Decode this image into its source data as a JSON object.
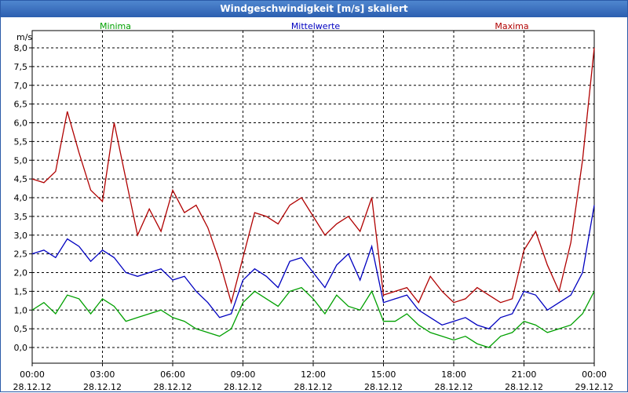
{
  "window": {
    "title": "Windgeschwindigkeit [m/s] skaliert"
  },
  "colors": {
    "minima": "#00a000",
    "mittelwerte": "#0000c0",
    "maxima": "#b00000",
    "grid": "#000000"
  },
  "chart_data": {
    "type": "line",
    "title": "Windgeschwindigkeit [m/s] skaliert",
    "ylabel": "m/s",
    "ylim": [
      0,
      8
    ],
    "yticks": [
      "0,0",
      "0,5",
      "1,0",
      "1,5",
      "2,0",
      "2,5",
      "3,0",
      "3,5",
      "4,0",
      "4,5",
      "5,0",
      "5,5",
      "6,0",
      "6,5",
      "7,0",
      "7,5",
      "8,0"
    ],
    "xlim": [
      "28.12.12 00:00",
      "29.12.12 00:00"
    ],
    "xticks": [
      {
        "time": "00:00",
        "date": "28.12.12"
      },
      {
        "time": "03:00",
        "date": "28.12.12"
      },
      {
        "time": "06:00",
        "date": "28.12.12"
      },
      {
        "time": "09:00",
        "date": "28.12.12"
      },
      {
        "time": "12:00",
        "date": "28.12.12"
      },
      {
        "time": "15:00",
        "date": "28.12.12"
      },
      {
        "time": "18:00",
        "date": "28.12.12"
      },
      {
        "time": "21:00",
        "date": "28.12.12"
      },
      {
        "time": "00:00",
        "date": "29.12.12"
      }
    ],
    "grid": true,
    "legend": "top",
    "series": [
      {
        "name": "Minima",
        "color": "#00a000",
        "x_hours": [
          0,
          0.5,
          1,
          1.5,
          2,
          2.5,
          3,
          3.5,
          4,
          4.5,
          5,
          5.5,
          6,
          6.5,
          7,
          7.5,
          8,
          8.5,
          9,
          9.5,
          10,
          10.5,
          11,
          11.5,
          12,
          12.5,
          13,
          13.5,
          14,
          14.5,
          15,
          15.5,
          16,
          16.5,
          17,
          17.5,
          18,
          18.5,
          19,
          19.5,
          20,
          20.5,
          21,
          21.5,
          22,
          22.5,
          23,
          23.5,
          24
        ],
        "values": [
          1.0,
          1.2,
          0.9,
          1.4,
          1.3,
          0.9,
          1.3,
          1.1,
          0.7,
          0.8,
          0.9,
          1.0,
          0.8,
          0.7,
          0.5,
          0.4,
          0.3,
          0.5,
          1.2,
          1.5,
          1.3,
          1.1,
          1.5,
          1.6,
          1.3,
          0.9,
          1.4,
          1.1,
          1.0,
          1.5,
          0.7,
          0.7,
          0.9,
          0.6,
          0.4,
          0.3,
          0.2,
          0.3,
          0.1,
          0.0,
          0.3,
          0.4,
          0.7,
          0.6,
          0.4,
          0.5,
          0.6,
          0.9,
          1.5
        ]
      },
      {
        "name": "Mittelwerte",
        "color": "#0000c0",
        "x_hours": [
          0,
          0.5,
          1,
          1.5,
          2,
          2.5,
          3,
          3.5,
          4,
          4.5,
          5,
          5.5,
          6,
          6.5,
          7,
          7.5,
          8,
          8.5,
          9,
          9.5,
          10,
          10.5,
          11,
          11.5,
          12,
          12.5,
          13,
          13.5,
          14,
          14.5,
          15,
          15.5,
          16,
          16.5,
          17,
          17.5,
          18,
          18.5,
          19,
          19.5,
          20,
          20.5,
          21,
          21.5,
          22,
          22.5,
          23,
          23.5,
          24
        ],
        "values": [
          2.5,
          2.6,
          2.4,
          2.9,
          2.7,
          2.3,
          2.6,
          2.4,
          2.0,
          1.9,
          2.0,
          2.1,
          1.8,
          1.9,
          1.5,
          1.2,
          0.8,
          0.9,
          1.8,
          2.1,
          1.9,
          1.6,
          2.3,
          2.4,
          2.0,
          1.6,
          2.2,
          2.5,
          1.8,
          2.7,
          1.2,
          1.3,
          1.4,
          1.0,
          0.8,
          0.6,
          0.7,
          0.8,
          0.6,
          0.5,
          0.8,
          0.9,
          1.5,
          1.4,
          1.0,
          1.2,
          1.4,
          2.0,
          3.8
        ]
      },
      {
        "name": "Maxima",
        "color": "#b00000",
        "x_hours": [
          0,
          0.5,
          1,
          1.5,
          2,
          2.5,
          3,
          3.5,
          4,
          4.5,
          5,
          5.5,
          6,
          6.5,
          7,
          7.5,
          8,
          8.5,
          9,
          9.5,
          10,
          10.5,
          11,
          11.5,
          12,
          12.5,
          13,
          13.5,
          14,
          14.5,
          15,
          15.5,
          16,
          16.5,
          17,
          17.5,
          18,
          18.5,
          19,
          19.5,
          20,
          20.5,
          21,
          21.5,
          22,
          22.5,
          23,
          23.5,
          24
        ],
        "values": [
          4.5,
          4.4,
          4.7,
          6.3,
          5.2,
          4.2,
          3.9,
          6.0,
          4.5,
          3.0,
          3.7,
          3.1,
          4.2,
          3.6,
          3.8,
          3.2,
          2.3,
          1.2,
          2.4,
          3.6,
          3.5,
          3.3,
          3.8,
          4.0,
          3.5,
          3.0,
          3.3,
          3.5,
          3.1,
          4.0,
          1.4,
          1.5,
          1.6,
          1.2,
          1.9,
          1.5,
          1.2,
          1.3,
          1.6,
          1.4,
          1.2,
          1.3,
          2.6,
          3.1,
          2.2,
          1.5,
          2.8,
          5.0,
          8.0
        ]
      }
    ]
  }
}
